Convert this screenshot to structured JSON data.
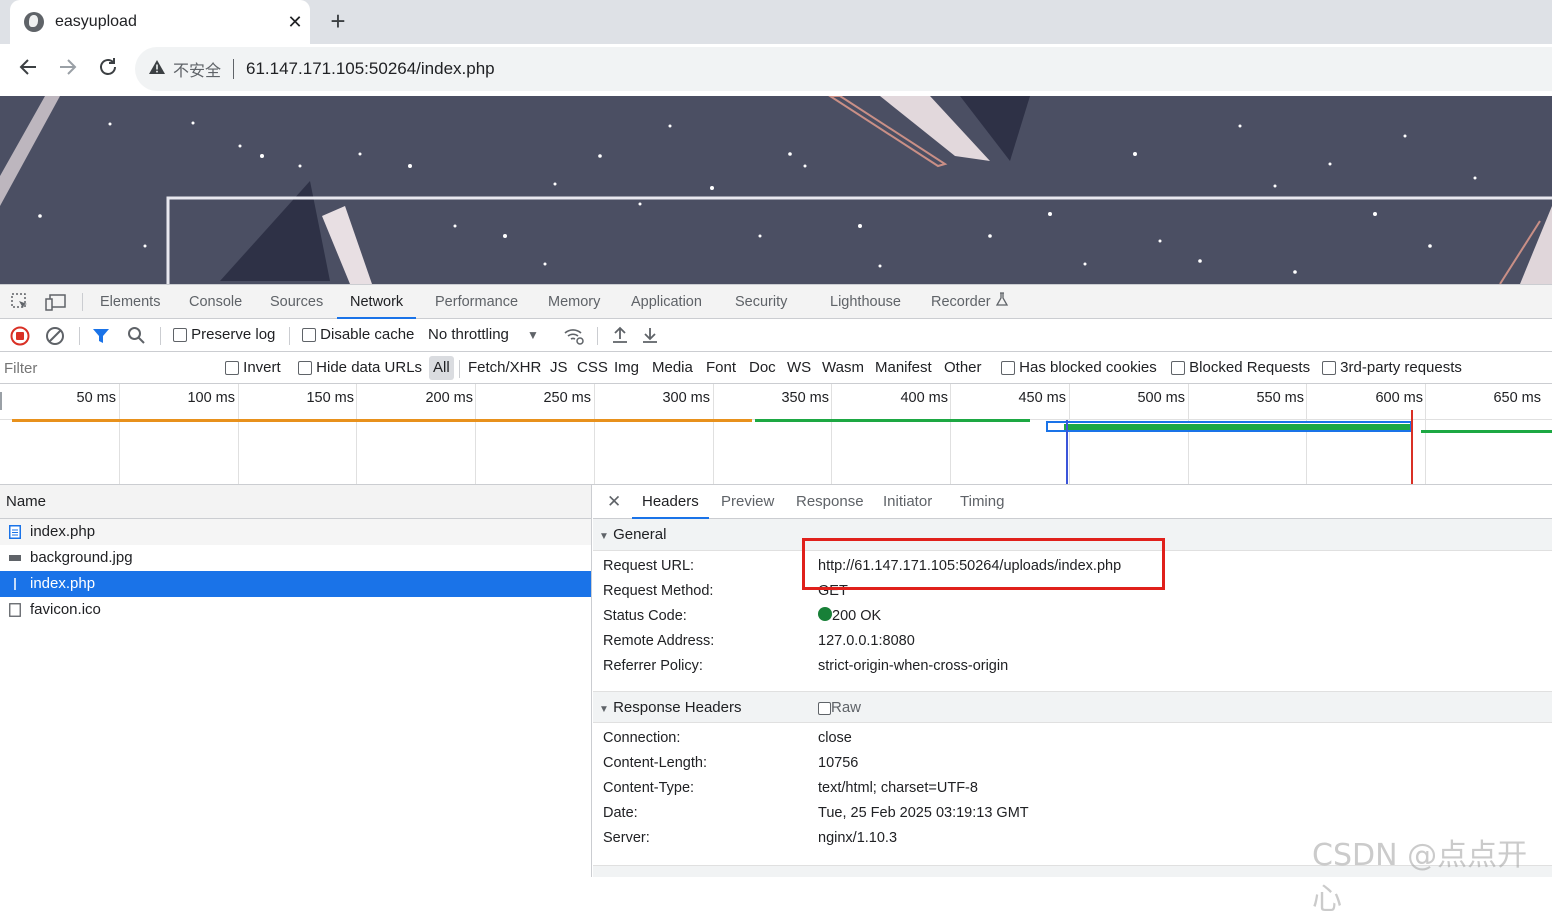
{
  "browser": {
    "tab_title": "easyupload",
    "tab_close": "✕",
    "new_tab": "+",
    "insecure_label": "不安全",
    "url": "61.147.171.105:50264/index.php"
  },
  "devtools": {
    "tabs": [
      "Elements",
      "Console",
      "Sources",
      "Network",
      "Performance",
      "Memory",
      "Application",
      "Security",
      "Lighthouse",
      "Recorder"
    ],
    "active_tab": "Network",
    "network_toolbar": {
      "preserve_log": "Preserve log",
      "disable_cache": "Disable cache",
      "throttling": "No throttling"
    },
    "filterbar": {
      "placeholder": "Filter",
      "invert": "Invert",
      "hide_data_urls": "Hide data URLs",
      "types": [
        "All",
        "Fetch/XHR",
        "JS",
        "CSS",
        "Img",
        "Media",
        "Font",
        "Doc",
        "WS",
        "Wasm",
        "Manifest",
        "Other"
      ],
      "has_blocked_cookies": "Has blocked cookies",
      "blocked_requests": "Blocked Requests",
      "third_party": "3rd-party requests"
    },
    "timeline_ticks": [
      "50 ms",
      "100 ms",
      "150 ms",
      "200 ms",
      "250 ms",
      "300 ms",
      "350 ms",
      "400 ms",
      "450 ms",
      "500 ms",
      "550 ms",
      "600 ms",
      "650 ms"
    ],
    "request_list": {
      "header": "Name",
      "rows": [
        {
          "name": "index.php",
          "type": "doc"
        },
        {
          "name": "background.jpg",
          "type": "img"
        },
        {
          "name": "index.php",
          "type": "doc-selected"
        },
        {
          "name": "favicon.ico",
          "type": "other"
        }
      ]
    },
    "details": {
      "close": "✕",
      "tabs": [
        "Headers",
        "Preview",
        "Response",
        "Initiator",
        "Timing"
      ],
      "active_tab": "Headers",
      "general": {
        "title": "General",
        "rows": [
          {
            "k": "Request URL:",
            "v": "http://61.147.171.105:50264/uploads/index.php"
          },
          {
            "k": "Request Method:",
            "v": "GET"
          },
          {
            "k": "Status Code:",
            "v": "200 OK"
          },
          {
            "k": "Remote Address:",
            "v": "127.0.0.1:8080"
          },
          {
            "k": "Referrer Policy:",
            "v": "strict-origin-when-cross-origin"
          }
        ]
      },
      "response_headers": {
        "title": "Response Headers",
        "raw_label": "Raw",
        "rows": [
          {
            "k": "Connection:",
            "v": "close"
          },
          {
            "k": "Content-Length:",
            "v": "10756"
          },
          {
            "k": "Content-Type:",
            "v": "text/html; charset=UTF-8"
          },
          {
            "k": "Date:",
            "v": "Tue, 25 Feb 2025 03:19:13 GMT"
          },
          {
            "k": "Server:",
            "v": "nginx/1.10.3"
          }
        ]
      }
    }
  },
  "watermark": "CSDN @点点开心",
  "colors": {
    "accent": "#1a73e8",
    "highlight_box": "#e0201b",
    "status_ok": "#188038",
    "page_bg": "#4b4f63"
  }
}
